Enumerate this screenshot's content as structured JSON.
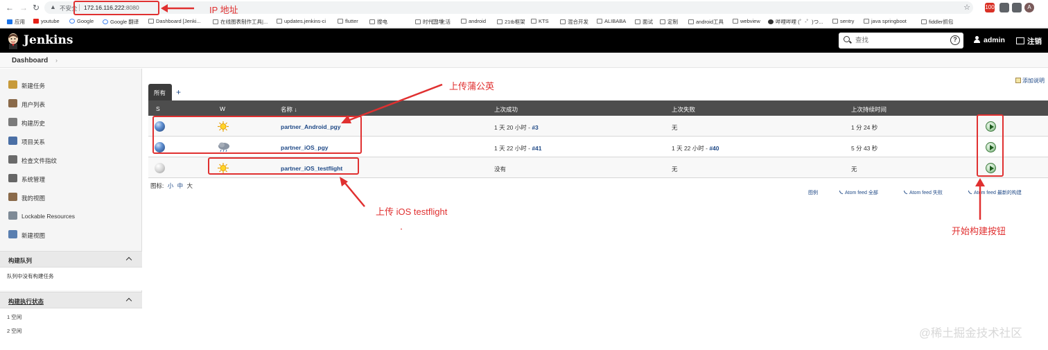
{
  "browser": {
    "insecure_label": "不安全",
    "url_host": "172.16.116.222",
    "url_port": ":8080",
    "extensions": [
      {
        "name": "extension-100-icon",
        "label": "100",
        "color": "#d93025"
      },
      {
        "name": "extension-bookmark-icon",
        "label": "",
        "color": "#5f6368"
      },
      {
        "name": "extension-puzzle-icon",
        "label": "",
        "color": "#5f6368"
      },
      {
        "name": "profile-avatar-icon",
        "label": "A",
        "color": "#7a5a5a"
      }
    ]
  },
  "bookmarks": [
    {
      "label": "应用",
      "icon": "grid"
    },
    {
      "label": "youtube",
      "icon": "yt"
    },
    {
      "label": "Google",
      "icon": "g"
    },
    {
      "label": "Google 翻译",
      "icon": "g"
    },
    {
      "label": "Dashboard [Jenki...",
      "icon": "folder"
    },
    {
      "label": "在线图表制作工具|...",
      "icon": "folder"
    },
    {
      "label": "updates.jenkins-ci",
      "icon": "folder"
    },
    {
      "label": "flutter",
      "icon": "folder"
    },
    {
      "label": "搜电",
      "icon": "folder"
    },
    {
      "label": "时代光华",
      "icon": "folder"
    },
    {
      "label": "生活",
      "icon": "folder"
    },
    {
      "label": "android",
      "icon": "folder"
    },
    {
      "label": "21tb框架",
      "icon": "folder"
    },
    {
      "label": "KTS",
      "icon": "folder"
    },
    {
      "label": "混合开发",
      "icon": "folder"
    },
    {
      "label": "ALIBABA",
      "icon": "folder"
    },
    {
      "label": "面试",
      "icon": "folder"
    },
    {
      "label": "定制",
      "icon": "folder"
    },
    {
      "label": "android工具",
      "icon": "folder"
    },
    {
      "label": "webview",
      "icon": "folder"
    },
    {
      "label": "哔哩哔哩 (゜-゜)つ...",
      "icon": "circ"
    },
    {
      "label": "sentry",
      "icon": "folder"
    },
    {
      "label": "java springboot",
      "icon": "folder"
    },
    {
      "label": "fiddler抓包",
      "icon": "folder"
    }
  ],
  "header": {
    "title": "Jenkins",
    "search_placeholder": "查找",
    "help": "?",
    "user": "admin",
    "logout": "注销"
  },
  "breadcrumb": {
    "dashboard": "Dashboard",
    "chevron": "›"
  },
  "sidebar": {
    "items": [
      {
        "label": "新建任务",
        "icon": "new-task-icon",
        "color": "#c79a3a"
      },
      {
        "label": "用户列表",
        "icon": "users-icon",
        "color": "#8a6a4a"
      },
      {
        "label": "构建历史",
        "icon": "history-icon",
        "color": "#7a7a7a"
      },
      {
        "label": "项目关系",
        "icon": "magnifier-icon",
        "color": "#4a6fa5"
      },
      {
        "label": "检查文件指纹",
        "icon": "fingerprint-icon",
        "color": "#6a6a6a"
      },
      {
        "label": "系统管理",
        "icon": "gear-icon",
        "color": "#666666"
      },
      {
        "label": "我的视图",
        "icon": "my-views-icon",
        "color": "#8a6a4a"
      },
      {
        "label": "Lockable Resources",
        "icon": "lock-resources-icon",
        "color": "#7e8a96"
      },
      {
        "label": "新建视图",
        "icon": "folder-icon",
        "color": "#5a7fb0"
      }
    ],
    "queue": {
      "title": "构建队列",
      "empty": "队列中没有构建任务"
    },
    "executors": {
      "title": "构建执行状态",
      "rows": [
        "1  空闲",
        "2  空闲"
      ]
    }
  },
  "main": {
    "add_description": "添加说明",
    "tab_all": "所有",
    "tab_add": "+",
    "columns": {
      "s": "S",
      "w": "W",
      "name": "名称 ↓",
      "last_success": "上次成功",
      "last_failure": "上次失败",
      "last_duration": "上次持续时间"
    },
    "jobs": [
      {
        "status": "blue",
        "weather": "sunny",
        "name": "partner_Android_pgy",
        "last_success_text": "1 天 20 小时 - ",
        "last_success_build": "#3",
        "last_failure_text": "无",
        "last_failure_build": "",
        "duration": "1 分 24 秒"
      },
      {
        "status": "blue",
        "weather": "cloudy",
        "name": "partner_iOS_pgy",
        "last_success_text": "1 天 22 小时 - ",
        "last_success_build": "#41",
        "last_failure_text": "1 天 22 小时 - ",
        "last_failure_build": "#40",
        "duration": "5 分 43 秒"
      },
      {
        "status": "grey",
        "weather": "sunny",
        "name": "partner_iOS_testflight",
        "last_success_text": "没有",
        "last_success_build": "",
        "last_failure_text": "无",
        "last_failure_build": "",
        "duration": "无"
      }
    ],
    "icon_size": {
      "label": "图标:",
      "small": "小",
      "medium": "中",
      "large": "大"
    },
    "feeds": {
      "legend": "图例",
      "atom_all": "Atom feed 全部",
      "atom_failed": "Atom feed 失败",
      "atom_latest": "Atom feed 最新的构建"
    }
  },
  "annotations": {
    "ip": "IP 地址",
    "pgy": "上传蒲公英",
    "testflight": "上传 iOS testflight",
    "build_button": "开始构建按钮",
    "color": "#e03030"
  },
  "watermark": "@稀土掘金技术社区"
}
